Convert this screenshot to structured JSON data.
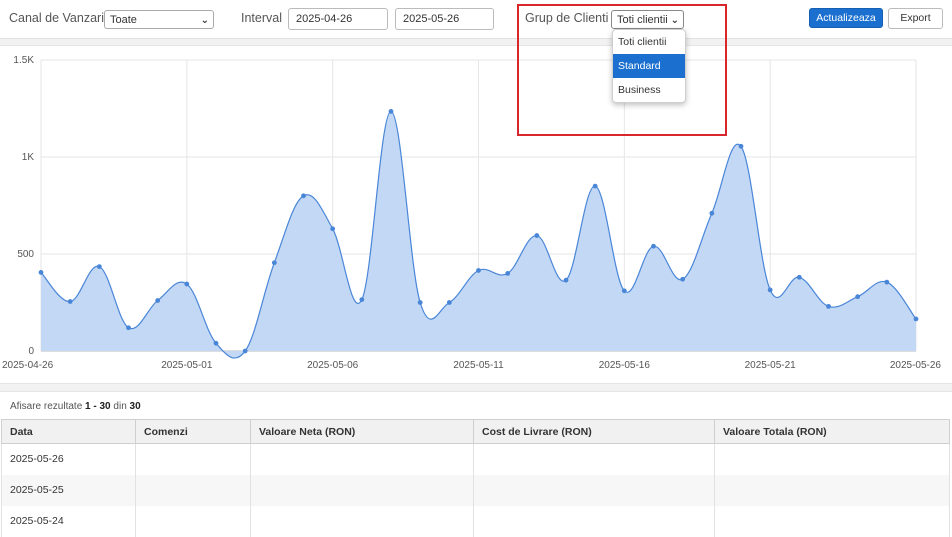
{
  "filters": {
    "channel_label": "Canal de Vanzari",
    "channel_value": "Toate",
    "interval_label": "Interval",
    "date_from": "2025-04-26",
    "date_to": "2025-05-26",
    "group_label": "Grup de Clienti",
    "group_value": "Toti clientii",
    "group_options": [
      "Toti clientii",
      "Standard",
      "Business"
    ],
    "update_button": "Actualizeaza",
    "export_button": "Export"
  },
  "colors": {
    "accent": "#1a6fcf",
    "series_line": "#4a86d8",
    "series_fill": "#c3d8f4",
    "highlight": "#d9262c"
  },
  "chart_data": {
    "type": "area",
    "x_ticks": [
      "2025-04-26",
      "2025-05-01",
      "2025-05-06",
      "2025-05-11",
      "2025-05-16",
      "2025-05-21",
      "2025-05-26"
    ],
    "y_ticks": [
      "0",
      "500",
      "1K",
      "1.5K"
    ],
    "ylim": [
      0,
      1500
    ],
    "x": [
      "2025-04-26",
      "2025-04-27",
      "2025-04-28",
      "2025-04-29",
      "2025-04-30",
      "2025-05-01",
      "2025-05-02",
      "2025-05-03",
      "2025-05-04",
      "2025-05-05",
      "2025-05-06",
      "2025-05-07",
      "2025-05-08",
      "2025-05-09",
      "2025-05-10",
      "2025-05-11",
      "2025-05-12",
      "2025-05-13",
      "2025-05-14",
      "2025-05-15",
      "2025-05-16",
      "2025-05-17",
      "2025-05-18",
      "2025-05-19",
      "2025-05-20",
      "2025-05-21",
      "2025-05-22",
      "2025-05-23",
      "2025-05-24",
      "2025-05-25",
      "2025-05-26"
    ],
    "values": [
      405,
      255,
      435,
      120,
      260,
      345,
      40,
      0,
      455,
      800,
      630,
      265,
      1235,
      250,
      250,
      415,
      400,
      595,
      365,
      850,
      310,
      540,
      370,
      710,
      1055,
      315,
      380,
      230,
      280,
      355,
      165
    ],
    "grid": true
  },
  "results": {
    "prefix": "Afisare rezultate",
    "range": "1 - 30",
    "of": "din",
    "total": "30"
  },
  "table": {
    "columns": [
      "Data",
      "Comenzi",
      "Valoare Neta (RON)",
      "Cost de Livrare (RON)",
      "Valoare Totala (RON)"
    ],
    "rows": [
      [
        "2025-05-26",
        "",
        "",
        "",
        ""
      ],
      [
        "2025-05-25",
        "",
        "",
        "",
        ""
      ],
      [
        "2025-05-24",
        "",
        "",
        "",
        ""
      ]
    ]
  }
}
